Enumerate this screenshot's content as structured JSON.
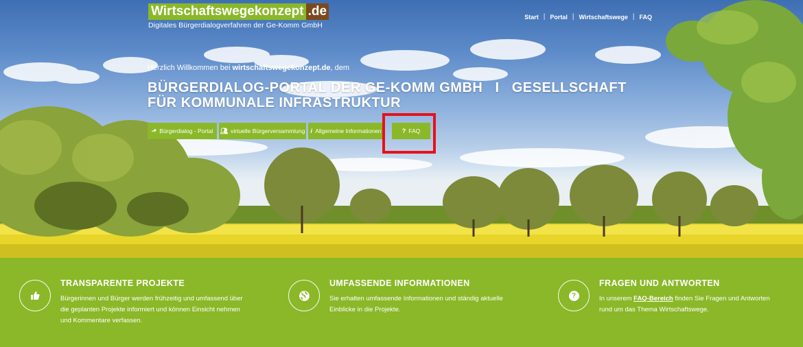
{
  "logo": {
    "main": "Wirtschaftswegekonzept",
    "tld": ".de",
    "subtitle": "Digitales Bürgerdialogverfahren der Ge-Komm GmbH"
  },
  "nav": {
    "items": [
      "Start",
      "Portal",
      "Wirtschaftswege",
      "FAQ"
    ]
  },
  "hero": {
    "welcome_prefix": "Herzlich Willkommen bei ",
    "welcome_site": "wirtschaftswegekonzept.de",
    "welcome_suffix": ", dem",
    "headline_line1": "BÜRGERDIALOG-PORTAL DER GE-KOMM GMBH   I   GESELLSCHAFT",
    "headline_line2": "FÜR KOMMUNALE INFRASTRUKTUR"
  },
  "buttons": [
    {
      "icon": "compass-icon",
      "label": "Bürgerdialog - Portal"
    },
    {
      "icon": "users-icon",
      "label": "virtuelle Bürgerversammlung"
    },
    {
      "icon": "info-icon",
      "label": "Allgemeine Informationen"
    },
    {
      "icon": "question-icon",
      "label": "FAQ"
    }
  ],
  "features": [
    {
      "icon": "thumbs-up-icon",
      "title": "TRANSPARENTE PROJEKTE",
      "text": "Bürgerinnen und Bürger werden frühzeitig und umfassend über die geplanten Projekte informiert und können Einsicht nehmen und Kommentare verfassen."
    },
    {
      "icon": "globe-icon",
      "title": "UMFASSENDE INFORMATIONEN",
      "text": "Sie erhalten umfassende Informationen und ständig aktuelle Einblicke in die Projekte."
    },
    {
      "icon": "question-circle-icon",
      "title": "FRAGEN UND ANTWORTEN",
      "text_prefix": "In unserem ",
      "link": "FAQ-Bereich",
      "text_suffix": " finden Sie Fragen und Antworten rund um das Thema Wirtschaftswege."
    }
  ],
  "colors": {
    "brand_green": "#8ab828",
    "logo_brown": "#7a4a1e",
    "highlight_red": "#e8101a"
  }
}
